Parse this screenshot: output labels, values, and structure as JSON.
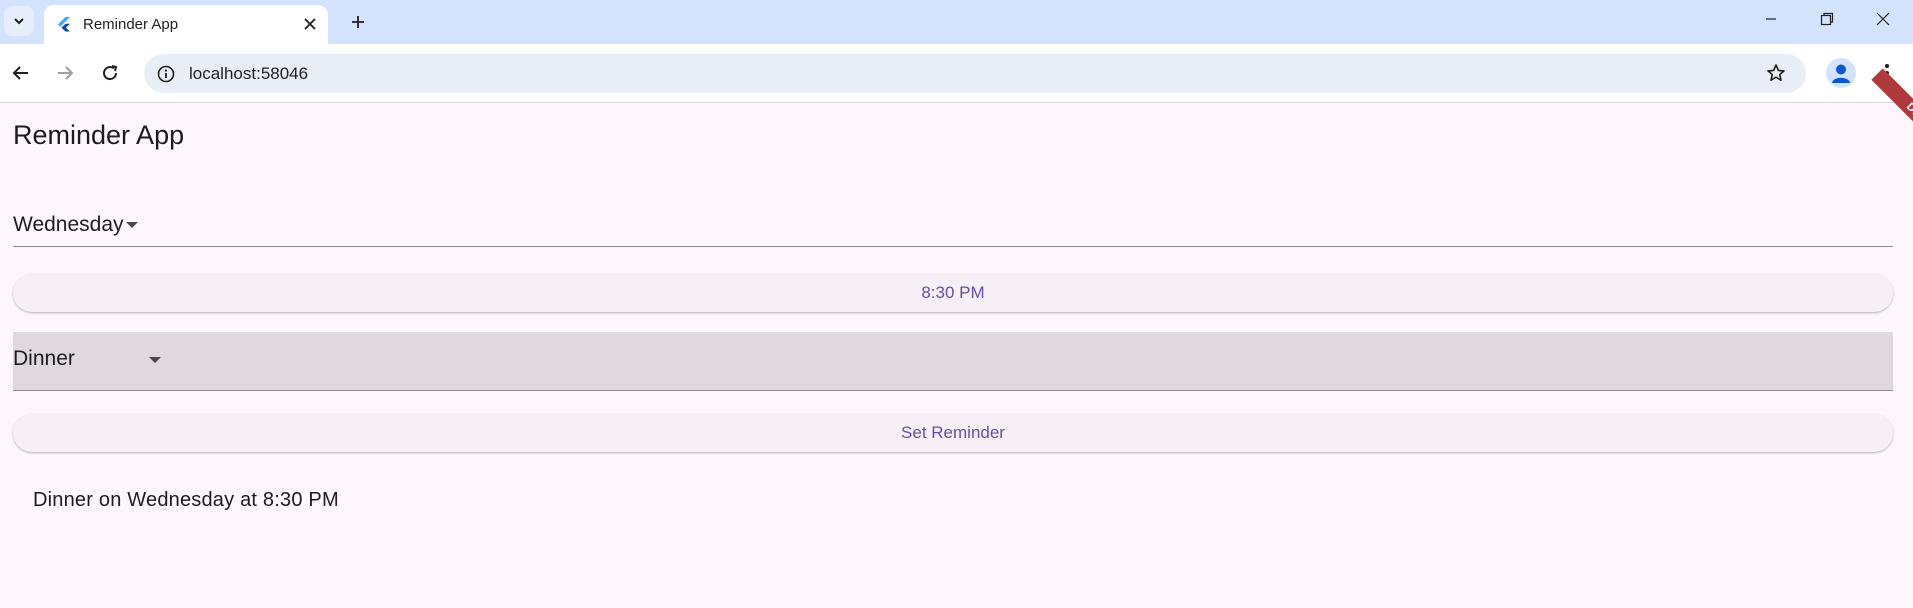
{
  "browser": {
    "tab_title": "Reminder App",
    "url": "localhost:58046",
    "colors": {
      "tabbar": "#d3e3fd",
      "omnibox": "#e9eef6"
    }
  },
  "app": {
    "title": "Reminder App",
    "day_dropdown": {
      "selected": "Wednesday"
    },
    "time_button": {
      "label": "8:30 PM"
    },
    "meal_dropdown": {
      "selected": "Dinner"
    },
    "set_button": {
      "label": "Set Reminder"
    },
    "result_text": "Dinner on Wednesday at 8:30 PM",
    "debug_banner": "DEBUG",
    "colors": {
      "accent": "#6750a4",
      "background": "#fdf6fd",
      "banner": "#b0393d"
    }
  }
}
